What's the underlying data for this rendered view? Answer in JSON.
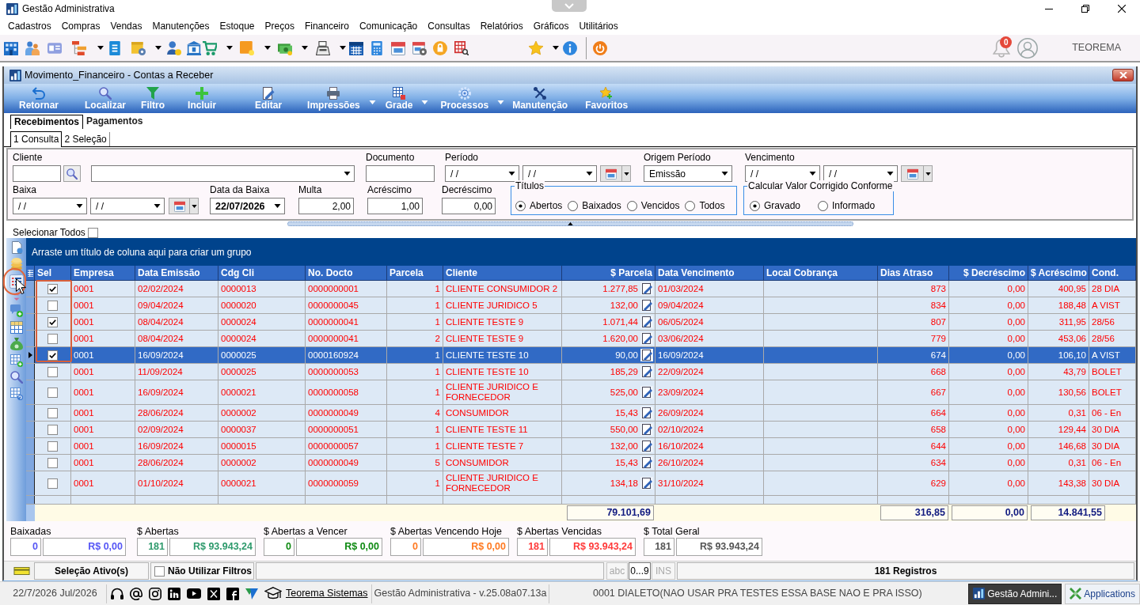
{
  "app": {
    "title": "Gestão Administrativa"
  },
  "menu": [
    "Cadastros",
    "Compras",
    "Vendas",
    "Manutenções",
    "Estoque",
    "Preços",
    "Financeiro",
    "Comunicação",
    "Consultas",
    "Relatórios",
    "Gráficos",
    "Utilitários"
  ],
  "notifications": {
    "count": "0"
  },
  "user": {
    "name": "TEOREMA"
  },
  "window": {
    "title": "Movimento_Financeiro - Contas a Receber",
    "toolbar": [
      {
        "label": "Retornar",
        "kind": "button"
      },
      {
        "label": "Localizar",
        "kind": "button"
      },
      {
        "label": "Filtro",
        "kind": "button"
      },
      {
        "label": "Incluir",
        "kind": "button"
      },
      {
        "label": "Editar",
        "kind": "button"
      },
      {
        "label": "Impressões",
        "kind": "dropdown"
      },
      {
        "label": "Grade",
        "kind": "dropdown"
      },
      {
        "label": "Processos",
        "kind": "dropdown"
      },
      {
        "label": "Manutenção",
        "kind": "button"
      },
      {
        "label": "Favoritos",
        "kind": "button"
      }
    ],
    "tabs": [
      {
        "label": "Recebimentos",
        "selected": true
      },
      {
        "label": "Pagamentos",
        "selected": false
      }
    ],
    "subtabs": [
      {
        "label": "1 Consulta",
        "selected": true
      },
      {
        "label": "2 Seleção",
        "selected": false
      }
    ],
    "filters": {
      "cliente": {
        "label": "Cliente"
      },
      "documento": {
        "label": "Documento"
      },
      "periodo": {
        "label": "Período",
        "from": "/ /",
        "to": "/ /"
      },
      "origem_periodo": {
        "label": "Origem Período",
        "value": "Emissão"
      },
      "vencimento": {
        "label": "Vencimento",
        "from": "/ /",
        "to": "/ /"
      },
      "baixa": {
        "label": "Baixa",
        "from": "/ /",
        "to": "/ /"
      },
      "data_baixa": {
        "label": "Data da Baixa",
        "value": "22/07/2026"
      },
      "multa": {
        "label": "Multa",
        "value": "2,00"
      },
      "acrescimo": {
        "label": "Acréscimo",
        "value": "1,00"
      },
      "decrescimo": {
        "label": "Decréscimo",
        "value": "0,00"
      },
      "titulos": {
        "title": "Títulos",
        "options": [
          {
            "label": "Abertos",
            "selected": true
          },
          {
            "label": "Baixados",
            "selected": false
          },
          {
            "label": "Vencidos",
            "selected": false
          },
          {
            "label": "Todos",
            "selected": false
          }
        ]
      },
      "calcular": {
        "title": "Calcular Valor Corrigido Conforme",
        "options": [
          {
            "label": "Gravado",
            "selected": true
          },
          {
            "label": "Informado",
            "selected": false
          }
        ]
      }
    },
    "select_all": {
      "label": "Selecionar Todos",
      "checked": false
    },
    "grid": {
      "group_hint": "Arraste um título de coluna aqui para criar um grupo",
      "columns": [
        "Sel",
        "Empresa",
        "Data Emissão",
        "Cdg Cli",
        "No. Docto",
        "Parcela",
        "Cliente",
        "$ Parcela",
        "Data Vencimento",
        "Local Cobrança",
        "Dias Atraso",
        "$ Decréscimo",
        "$ Acréscimo",
        "Cond."
      ],
      "rows": [
        {
          "checked": true,
          "selected": false,
          "empresa": "0001",
          "data_emissao": "02/02/2024",
          "cdg_cli": "0000013",
          "no_docto": "0000000001",
          "parcela": "1",
          "cliente": "CLIENTE CONSUMIDOR 2",
          "valor_parcela": "1.277,85",
          "data_vencimento": "01/03/2024",
          "dias_atraso": "873",
          "decrescimo": "0,00",
          "acrescimo": "400,95",
          "cond": "28 DIA"
        },
        {
          "checked": false,
          "selected": false,
          "empresa": "0001",
          "data_emissao": "09/04/2024",
          "cdg_cli": "0000020",
          "no_docto": "0000000045",
          "parcela": "1",
          "cliente": "CLIENTE JURIDICO 5",
          "valor_parcela": "132,00",
          "data_vencimento": "09/04/2024",
          "dias_atraso": "834",
          "decrescimo": "0,00",
          "acrescimo": "188,48",
          "cond": "A VIST"
        },
        {
          "checked": true,
          "selected": false,
          "empresa": "0001",
          "data_emissao": "08/04/2024",
          "cdg_cli": "0000024",
          "no_docto": "0000000041",
          "parcela": "1",
          "cliente": "CLIENTE TESTE 9",
          "valor_parcela": "1.071,44",
          "data_vencimento": "06/05/2024",
          "dias_atraso": "807",
          "decrescimo": "0,00",
          "acrescimo": "311,95",
          "cond": "28/56"
        },
        {
          "checked": false,
          "selected": false,
          "empresa": "0001",
          "data_emissao": "08/04/2024",
          "cdg_cli": "0000024",
          "no_docto": "0000000041",
          "parcela": "2",
          "cliente": "CLIENTE TESTE 9",
          "valor_parcela": "1.620,00",
          "data_vencimento": "03/06/2024",
          "dias_atraso": "779",
          "decrescimo": "0,00",
          "acrescimo": "453,06",
          "cond": "28/56"
        },
        {
          "checked": true,
          "selected": true,
          "empresa": "0001",
          "data_emissao": "16/09/2024",
          "cdg_cli": "0000025",
          "no_docto": "0000160924",
          "parcela": "1",
          "cliente": "CLIENTE TESTE 10",
          "valor_parcela": "90,00",
          "data_vencimento": "16/09/2024",
          "dias_atraso": "674",
          "decrescimo": "0,00",
          "acrescimo": "106,10",
          "cond": "A VIST"
        },
        {
          "checked": false,
          "selected": false,
          "empresa": "0001",
          "data_emissao": "11/09/2024",
          "cdg_cli": "0000025",
          "no_docto": "0000000053",
          "parcela": "1",
          "cliente": "CLIENTE TESTE 10",
          "valor_parcela": "185,29",
          "data_vencimento": "22/09/2024",
          "dias_atraso": "668",
          "decrescimo": "0,00",
          "acrescimo": "43,79",
          "cond": "BOLET"
        },
        {
          "checked": false,
          "selected": false,
          "empresa": "0001",
          "data_emissao": "16/09/2024",
          "cdg_cli": "0000021",
          "no_docto": "0000000058",
          "parcela": "1",
          "cliente": "CLIENTE JURIDICO E FORNECEDOR",
          "valor_parcela": "525,00",
          "data_vencimento": "23/09/2024",
          "dias_atraso": "667",
          "decrescimo": "0,00",
          "acrescimo": "130,56",
          "cond": "BOLET"
        },
        {
          "checked": false,
          "selected": false,
          "empresa": "0001",
          "data_emissao": "28/06/2024",
          "cdg_cli": "0000002",
          "no_docto": "0000000049",
          "parcela": "4",
          "cliente": "CONSUMIDOR",
          "valor_parcela": "15,43",
          "data_vencimento": "26/09/2024",
          "dias_atraso": "664",
          "decrescimo": "0,00",
          "acrescimo": "0,31",
          "cond": "06 - En"
        },
        {
          "checked": false,
          "selected": false,
          "empresa": "0001",
          "data_emissao": "02/09/2024",
          "cdg_cli": "0000037",
          "no_docto": "0000000051",
          "parcela": "1",
          "cliente": "CLIENTE TESTE 11",
          "valor_parcela": "550,00",
          "data_vencimento": "02/10/2024",
          "dias_atraso": "658",
          "decrescimo": "0,00",
          "acrescimo": "129,44",
          "cond": "30 DIA"
        },
        {
          "checked": false,
          "selected": false,
          "empresa": "0001",
          "data_emissao": "16/09/2024",
          "cdg_cli": "0000015",
          "no_docto": "0000000057",
          "parcela": "1",
          "cliente": "CLIENTE TESTE 7",
          "valor_parcela": "132,00",
          "data_vencimento": "16/10/2024",
          "dias_atraso": "644",
          "decrescimo": "0,00",
          "acrescimo": "146,68",
          "cond": "30 DIA"
        },
        {
          "checked": false,
          "selected": false,
          "empresa": "0001",
          "data_emissao": "28/06/2024",
          "cdg_cli": "0000002",
          "no_docto": "0000000049",
          "parcela": "5",
          "cliente": "CONSUMIDOR",
          "valor_parcela": "15,43",
          "data_vencimento": "26/10/2024",
          "dias_atraso": "634",
          "decrescimo": "0,00",
          "acrescimo": "0,31",
          "cond": "06 - En"
        },
        {
          "checked": false,
          "selected": false,
          "empresa": "0001",
          "data_emissao": "01/10/2024",
          "cdg_cli": "0000021",
          "no_docto": "0000000059",
          "parcela": "1",
          "cliente": "CLIENTE JURIDICO E FORNECEDOR",
          "valor_parcela": "134,18",
          "data_vencimento": "31/10/2024",
          "dias_atraso": "629",
          "decrescimo": "0,00",
          "acrescimo": "143,38",
          "cond": "30 DIA"
        }
      ],
      "totals": {
        "valor_parcela": "79.101,69",
        "dias_atraso": "316,85",
        "decrescimo": "0,00",
        "acrescimo": "14.841,55"
      }
    },
    "summary": [
      {
        "label": "Baixadas",
        "count": "0",
        "value": "R$ 0,00",
        "color": "#5656f5"
      },
      {
        "label": "$ Abertas",
        "count": "181",
        "value": "R$ 93.943,24",
        "color": "#2e9a6c"
      },
      {
        "label": "$ Abertas a Vencer",
        "count": "0",
        "value": "R$ 0,00",
        "color": "#0e8a12"
      },
      {
        "label": "$ Abertas Vencendo Hoje",
        "count": "0",
        "value": "R$ 0,00",
        "color": "#ff7a22"
      },
      {
        "label": "$ Abertas Vencidas",
        "count": "181",
        "value": "R$ 93.943,24",
        "color": "#ff3a3a"
      },
      {
        "label": "$ Total Geral",
        "count": "181",
        "value": "R$ 93.943,24",
        "color": "#555555"
      }
    ],
    "status_bar": {
      "selection": "Seleção Ativo(s)",
      "no_filters": {
        "label": "Não Utilizar Filtros",
        "checked": false
      },
      "indicators": [
        {
          "label": "abc",
          "active": false
        },
        {
          "label": "0...9",
          "active": true
        },
        {
          "label": "INS",
          "active": false
        }
      ],
      "records": "181 Registros"
    }
  },
  "footer": {
    "date": "22/7/2026 Jul/2026",
    "link": "Teorema Sistemas",
    "version": "Gestão Administrativa - v.25.08a07.13a",
    "database": "0001 DIALETO(NAO USAR PRA TESTES ESSA BASE NAO E PRA ISSO)",
    "tasks": [
      {
        "label": "Gestão Admini...",
        "selected": true
      },
      {
        "label": "Applications",
        "selected": false
      }
    ]
  }
}
